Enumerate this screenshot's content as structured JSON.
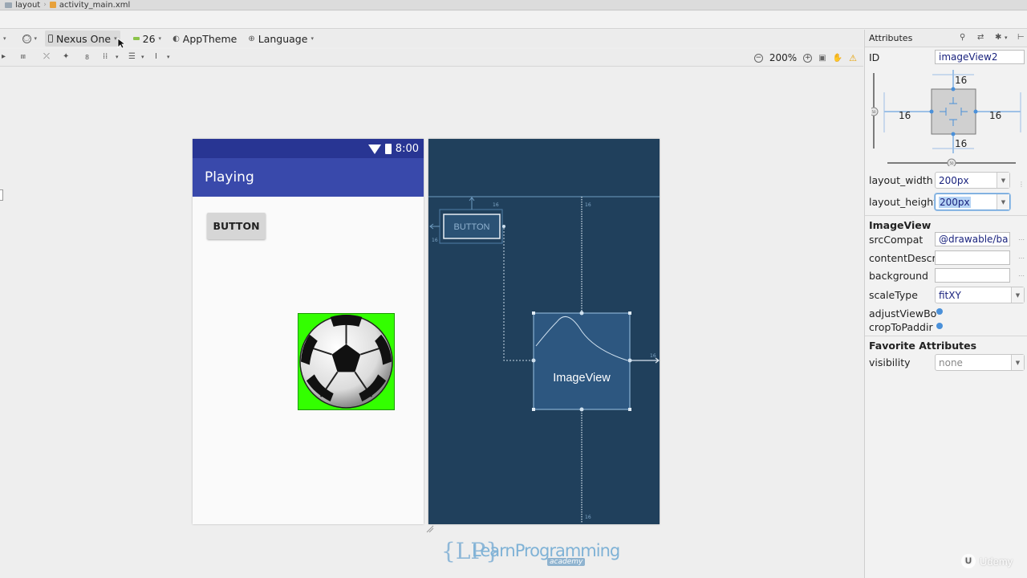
{
  "breadcrumb": {
    "items": [
      "layout",
      "activity_main.xml"
    ]
  },
  "design_toolbar": {
    "device": "Nexus One",
    "api_level": "26",
    "theme": "AppTheme",
    "language": "Language",
    "zoom": "200%"
  },
  "preview": {
    "status_time": "8:00",
    "app_title": "Playing",
    "button_label": "BUTTON"
  },
  "blueprint": {
    "button_label": "BUTTON",
    "imageview_label": "ImageView",
    "margin_labels": [
      "16",
      "16",
      "16",
      "16",
      "16"
    ]
  },
  "attributes": {
    "title": "Attributes",
    "id_label": "ID",
    "id_value": "imageView2",
    "constraints": {
      "top": "16",
      "bottom": "16",
      "left": "16",
      "right": "16",
      "bias_v": "50",
      "bias_h": "50"
    },
    "layout_width_label": "layout_width",
    "layout_width_value": "200px",
    "layout_height_label": "layout_height",
    "layout_height_value": "200px",
    "section_imageview": "ImageView",
    "srcCompat_label": "srcCompat",
    "srcCompat_value": "@drawable/ba",
    "contentDescription_label": "contentDescri",
    "contentDescription_value": "",
    "background_label": "background",
    "background_value": "",
    "scaleType_label": "scaleType",
    "scaleType_value": "fitXY",
    "adjustViewBounds_label": "adjustViewBo",
    "cropToPadding_label": "cropToPaddir",
    "section_favorite": "Favorite Attributes",
    "visibility_label": "visibility",
    "visibility_value": "none"
  },
  "logo": {
    "main": "LearnProgramming",
    "sub": "academy",
    "brace": "{LP}"
  },
  "watermark": {
    "text": "Udemy"
  },
  "colors": {
    "statusbar": "#283593",
    "appbar": "#3949ab",
    "blueprint": "#20405c",
    "image_bg": "#33ff00",
    "accent": "#4a90d9"
  },
  "icons": [
    "folder-icon",
    "xml-file-icon",
    "phone-icon",
    "api-icon",
    "theme-icon",
    "globe-icon",
    "zoom-out-icon",
    "zoom-in-icon",
    "warning-icon",
    "search-icon",
    "gear-icon",
    "wifi-icon",
    "battery-icon",
    "soccer-ball-icon",
    "udemy-logo-icon"
  ]
}
